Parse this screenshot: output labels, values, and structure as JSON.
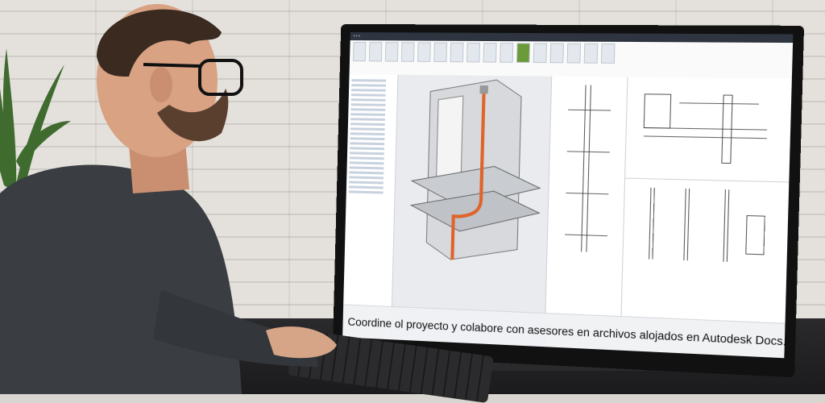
{
  "caption": "Coordine ol proyecto y colabore con asesores en archivos alojados en Autodesk Docs.",
  "colors": {
    "pipe": "#e0632a",
    "screen_bg": "#f2f3f5",
    "ribbon_accent": "#6a9a3a"
  },
  "icons": [
    "plant",
    "person",
    "monitor",
    "keyboard",
    "mouse"
  ]
}
